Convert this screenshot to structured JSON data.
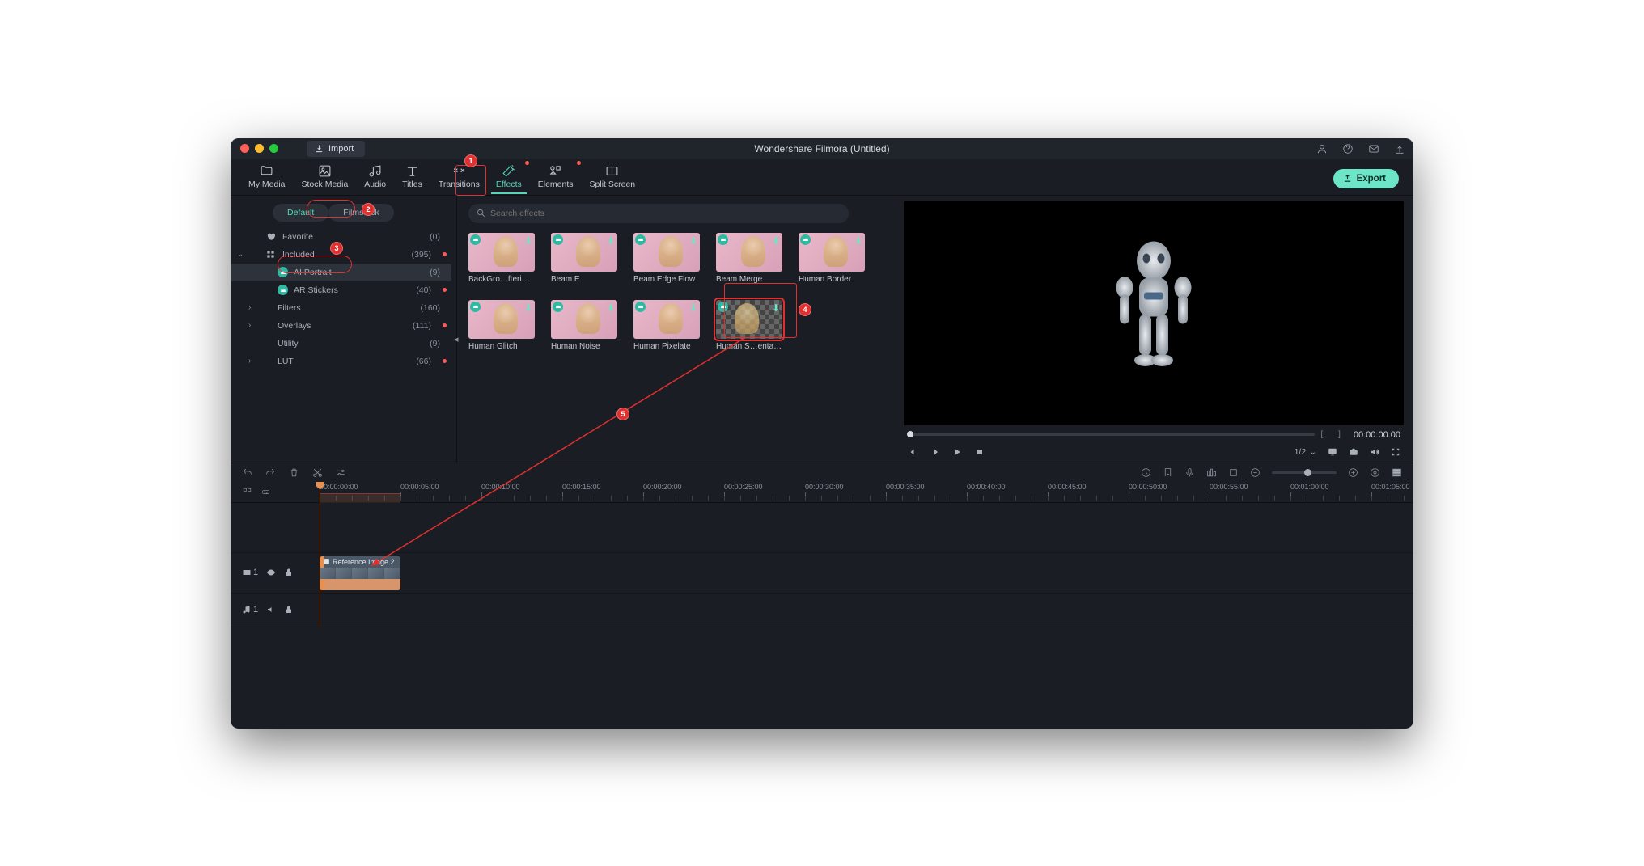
{
  "titlebar": {
    "import": "Import",
    "title": "Wondershare Filmora (Untitled)"
  },
  "tabs": {
    "mymedia": "My Media",
    "stockmedia": "Stock Media",
    "audio": "Audio",
    "titles": "Titles",
    "transitions": "Transitions",
    "effects": "Effects",
    "elements": "Elements",
    "splitscreen": "Split Screen"
  },
  "export": "Export",
  "pills": {
    "default": "Default",
    "filmstock": "Filmstock"
  },
  "tree": {
    "favorite": {
      "label": "Favorite",
      "count": "(0)"
    },
    "included": {
      "label": "Included",
      "count": "(395)"
    },
    "aiportrait": {
      "label": "AI Portrait",
      "count": "(9)"
    },
    "arstickers": {
      "label": "AR Stickers",
      "count": "(40)"
    },
    "filters": {
      "label": "Filters",
      "count": "(160)"
    },
    "overlays": {
      "label": "Overlays",
      "count": "(111)"
    },
    "utility": {
      "label": "Utility",
      "count": "(9)"
    },
    "lut": {
      "label": "LUT",
      "count": "(66)"
    }
  },
  "search": {
    "placeholder": "Search effects"
  },
  "effects": [
    {
      "label": "BackGro…fterimage"
    },
    {
      "label": "Beam E"
    },
    {
      "label": "Beam Edge Flow"
    },
    {
      "label": "Beam Merge"
    },
    {
      "label": "Human Border"
    },
    {
      "label": "Human Glitch"
    },
    {
      "label": "Human Noise"
    },
    {
      "label": "Human Pixelate"
    },
    {
      "label": "Human S…entation"
    }
  ],
  "preview": {
    "brackets": "[   ]",
    "time": "00:00:00:00",
    "quality": "1/2"
  },
  "ruler": [
    "00:00:00:00",
    "00:00:05:00",
    "00:00:10:00",
    "00:00:15:00",
    "00:00:20:00",
    "00:00:25:00",
    "00:00:30:00",
    "00:00:35:00",
    "00:00:40:00",
    "00:00:45:00",
    "00:00:50:00",
    "00:00:55:00",
    "00:01:00:00",
    "00:01:05:00"
  ],
  "timeline": {
    "clip_label": "Reference Image 2",
    "video_track_num": "1",
    "audio_track_num": "1"
  },
  "annotations": {
    "1": "1",
    "2": "2",
    "3": "3",
    "4": "4",
    "5": "5"
  }
}
